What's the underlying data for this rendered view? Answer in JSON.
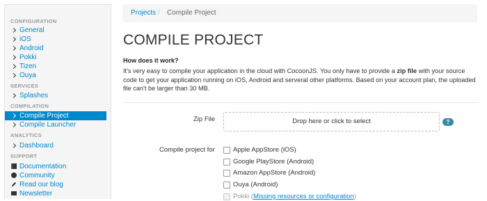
{
  "sidebar": {
    "sections": [
      {
        "header": "CONFIGURATION",
        "items": [
          {
            "label": "General",
            "icon": "chevron-right-icon"
          },
          {
            "label": "iOS",
            "icon": "chevron-right-icon"
          },
          {
            "label": "Android",
            "icon": "chevron-right-icon"
          },
          {
            "label": "Pokki",
            "icon": "chevron-right-icon"
          },
          {
            "label": "Tizen",
            "icon": "chevron-right-icon"
          },
          {
            "label": "Ouya",
            "icon": "chevron-right-icon"
          }
        ]
      },
      {
        "header": "SERVICES",
        "items": [
          {
            "label": "Splashes",
            "icon": "chevron-right-icon"
          }
        ]
      },
      {
        "header": "COMPILATION",
        "items": [
          {
            "label": "Compile Project",
            "icon": "chevron-right-icon",
            "active": true
          },
          {
            "label": "Compile Launcher",
            "icon": "chevron-right-icon"
          }
        ]
      },
      {
        "header": "ANALYTICS",
        "items": [
          {
            "label": "Dashboard",
            "icon": "chevron-right-icon"
          }
        ]
      },
      {
        "header": "SUPPORT",
        "items": [
          {
            "label": "Documentation",
            "icon": "book-icon"
          },
          {
            "label": "Community",
            "icon": "globe-icon"
          },
          {
            "label": "Read our blog",
            "icon": "pencil-icon"
          },
          {
            "label": "Newsletter",
            "icon": "envelope-icon"
          }
        ]
      }
    ]
  },
  "breadcrumb": {
    "link": "Projects",
    "separator": "/",
    "current": "Compile Project"
  },
  "page": {
    "title": "COMPILE PROJECT",
    "howto_heading": "How does it work?",
    "howto_text_before": "It's very easy to compile your application in the cloud with CocoonJS. You only have to provide a ",
    "howto_text_bold": "zip file",
    "howto_text_after": " with your source code to get your application running on iOS, Android and serveral other platforms. Based on your account plan, the uploaded file can't be larger than 30 MB."
  },
  "form": {
    "zip_label": "Zip File",
    "dropzone_text": "Drop here or click to select",
    "help_label": "?",
    "compile_label": "Compile project for",
    "options": [
      {
        "label": "Apple AppStore (iOS)"
      },
      {
        "label": "Google PlayStore (Android)"
      },
      {
        "label": "Amazon AppStore (Android)"
      },
      {
        "label": "Ouya (Android)"
      }
    ],
    "disabled_option": {
      "label": "Pokki (",
      "link": "Missing resources or configuration",
      "suffix": ")"
    }
  },
  "colors": {
    "accent": "#0088cc",
    "sidebar_bg": "#f5f5f5",
    "help_badge": "#3a87ad"
  }
}
